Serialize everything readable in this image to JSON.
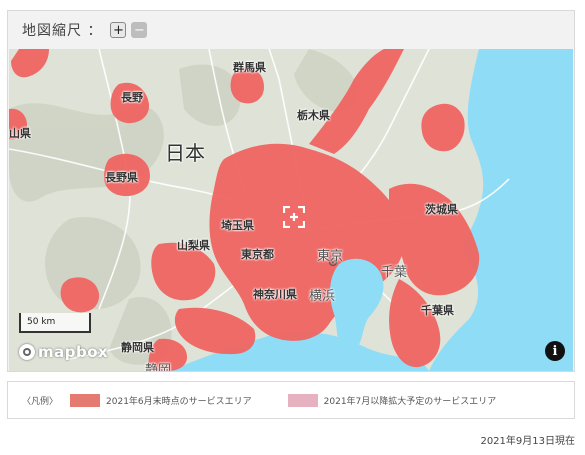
{
  "zoom": {
    "label": "地図縮尺 ：",
    "zoom_in_label": "+",
    "zoom_out_label": "−"
  },
  "map": {
    "labels": {
      "gunma": "群馬県",
      "nagano1": "長野",
      "yama": "山県",
      "nagano2": "長野県",
      "tochigi": "栃木県",
      "nihon": "日本",
      "saitama": "埼玉県",
      "ibaraki": "茨城県",
      "yamanashi": "山梨県",
      "tokyo_to": "東京都",
      "tokyo": "東京",
      "chiba_city": "千葉",
      "kanagawa": "神奈川県",
      "yokohama": "横浜",
      "chiba_pref": "千葉県",
      "shizuoka": "静岡県",
      "shizuoka_city": "静岡"
    },
    "scale_label": "50 km",
    "attribution": "mapbox",
    "info_label": "i",
    "colors": {
      "land": "#dfe3d7",
      "sea": "#8fdcf7",
      "coverage": "#f06562",
      "roads": "#ffffff"
    }
  },
  "legend": {
    "title": "〈凡例〉",
    "items": [
      {
        "label": "2021年6月末時点のサービスエリア",
        "color": "#e57a70"
      },
      {
        "label": "2021年7月以降拡大予定のサービスエリア",
        "color": "#e7b2c0"
      }
    ]
  },
  "footer": {
    "date_note": "2021年9月13日現在"
  }
}
